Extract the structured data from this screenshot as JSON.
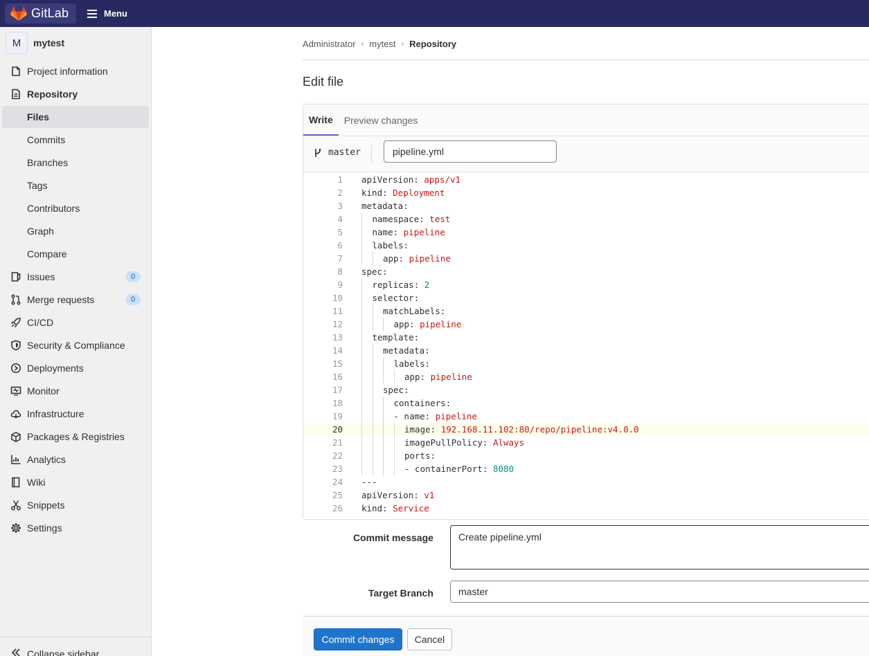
{
  "topbar": {
    "brand": "GitLab",
    "menu": "Menu"
  },
  "project": {
    "initial": "M",
    "name": "mytest"
  },
  "sidebar": {
    "items": [
      {
        "label": "Project information",
        "icon": "info-icon"
      },
      {
        "label": "Repository",
        "icon": "document-icon"
      },
      {
        "label": "Files"
      },
      {
        "label": "Commits"
      },
      {
        "label": "Branches"
      },
      {
        "label": "Tags"
      },
      {
        "label": "Contributors"
      },
      {
        "label": "Graph"
      },
      {
        "label": "Compare"
      },
      {
        "label": "Issues",
        "icon": "issues-icon",
        "badge": "0"
      },
      {
        "label": "Merge requests",
        "icon": "merge-request-icon",
        "badge": "0"
      },
      {
        "label": "CI/CD",
        "icon": "rocket-icon"
      },
      {
        "label": "Security & Compliance",
        "icon": "shield-icon"
      },
      {
        "label": "Deployments",
        "icon": "deployments-icon"
      },
      {
        "label": "Monitor",
        "icon": "monitor-icon"
      },
      {
        "label": "Infrastructure",
        "icon": "cloud-icon"
      },
      {
        "label": "Packages & Registries",
        "icon": "package-icon"
      },
      {
        "label": "Analytics",
        "icon": "chart-icon"
      },
      {
        "label": "Wiki",
        "icon": "book-icon"
      },
      {
        "label": "Snippets",
        "icon": "scissors-icon"
      },
      {
        "label": "Settings",
        "icon": "gear-icon"
      }
    ],
    "collapse": "Collapse sidebar"
  },
  "breadcrumb": {
    "a": "Administrator",
    "b": "mytest",
    "c": "Repository"
  },
  "page": {
    "title": "Edit file"
  },
  "editor": {
    "tab_write": "Write",
    "tab_preview": "Preview changes",
    "branch": "master",
    "filename": "pipeline.yml",
    "highlight_line": 20
  },
  "code_lines": [
    {
      "n": "1",
      "indent": 0,
      "parts": [
        [
          "k",
          "apiVersion: "
        ],
        [
          "s",
          "apps/v1"
        ]
      ]
    },
    {
      "n": "2",
      "indent": 0,
      "parts": [
        [
          "k",
          "kind: "
        ],
        [
          "s",
          "Deployment"
        ]
      ]
    },
    {
      "n": "3",
      "indent": 0,
      "parts": [
        [
          "k",
          "metadata:"
        ]
      ]
    },
    {
      "n": "4",
      "indent": 1,
      "parts": [
        [
          "k",
          "namespace: "
        ],
        [
          "s",
          "test"
        ]
      ]
    },
    {
      "n": "5",
      "indent": 1,
      "parts": [
        [
          "k",
          "name: "
        ],
        [
          "s",
          "pipeline"
        ]
      ]
    },
    {
      "n": "6",
      "indent": 1,
      "parts": [
        [
          "k",
          "labels:"
        ]
      ]
    },
    {
      "n": "7",
      "indent": 2,
      "parts": [
        [
          "k",
          "app: "
        ],
        [
          "s",
          "pipeline"
        ]
      ]
    },
    {
      "n": "8",
      "indent": 0,
      "parts": [
        [
          "k",
          "spec:"
        ]
      ]
    },
    {
      "n": "9",
      "indent": 1,
      "parts": [
        [
          "k",
          "replicas: "
        ],
        [
          "n",
          "2"
        ]
      ]
    },
    {
      "n": "10",
      "indent": 1,
      "parts": [
        [
          "k",
          "selector:"
        ]
      ]
    },
    {
      "n": "11",
      "indent": 2,
      "parts": [
        [
          "k",
          "matchLabels:"
        ]
      ]
    },
    {
      "n": "12",
      "indent": 3,
      "parts": [
        [
          "k",
          "app: "
        ],
        [
          "s",
          "pipeline"
        ]
      ]
    },
    {
      "n": "13",
      "indent": 1,
      "parts": [
        [
          "k",
          "template:"
        ]
      ]
    },
    {
      "n": "14",
      "indent": 2,
      "parts": [
        [
          "k",
          "metadata:"
        ]
      ]
    },
    {
      "n": "15",
      "indent": 3,
      "parts": [
        [
          "k",
          "labels:"
        ]
      ]
    },
    {
      "n": "16",
      "indent": 4,
      "parts": [
        [
          "k",
          "app: "
        ],
        [
          "s",
          "pipeline"
        ]
      ]
    },
    {
      "n": "17",
      "indent": 2,
      "parts": [
        [
          "k",
          "spec:"
        ]
      ]
    },
    {
      "n": "18",
      "indent": 3,
      "parts": [
        [
          "k",
          "containers:"
        ]
      ]
    },
    {
      "n": "19",
      "indent": 3,
      "parts": [
        [
          "k",
          "- name: "
        ],
        [
          "s",
          "pipeline"
        ]
      ]
    },
    {
      "n": "20",
      "indent": 4,
      "parts": [
        [
          "k",
          "image: "
        ],
        [
          "s",
          "192.168.11.102:80/repo/pipeline:v4.0.0"
        ]
      ]
    },
    {
      "n": "21",
      "indent": 4,
      "parts": [
        [
          "k",
          "imagePullPolicy: "
        ],
        [
          "s",
          "Always"
        ]
      ]
    },
    {
      "n": "22",
      "indent": 4,
      "parts": [
        [
          "k",
          "ports:"
        ]
      ]
    },
    {
      "n": "23",
      "indent": 4,
      "parts": [
        [
          "k",
          "- containerPort: "
        ],
        [
          "n",
          "8080"
        ]
      ]
    },
    {
      "n": "24",
      "indent": 0,
      "parts": [
        [
          "k",
          "---"
        ]
      ]
    },
    {
      "n": "25",
      "indent": 0,
      "parts": [
        [
          "k",
          "apiVersion: "
        ],
        [
          "s",
          "v1"
        ]
      ]
    },
    {
      "n": "26",
      "indent": 0,
      "parts": [
        [
          "k",
          "kind: "
        ],
        [
          "s",
          "Service"
        ]
      ]
    }
  ],
  "form": {
    "commit_label": "Commit message",
    "commit_value": "Create pipeline.yml",
    "target_label": "Target Branch",
    "target_value": "master",
    "commit_button": "Commit changes",
    "cancel_button": "Cancel"
  }
}
